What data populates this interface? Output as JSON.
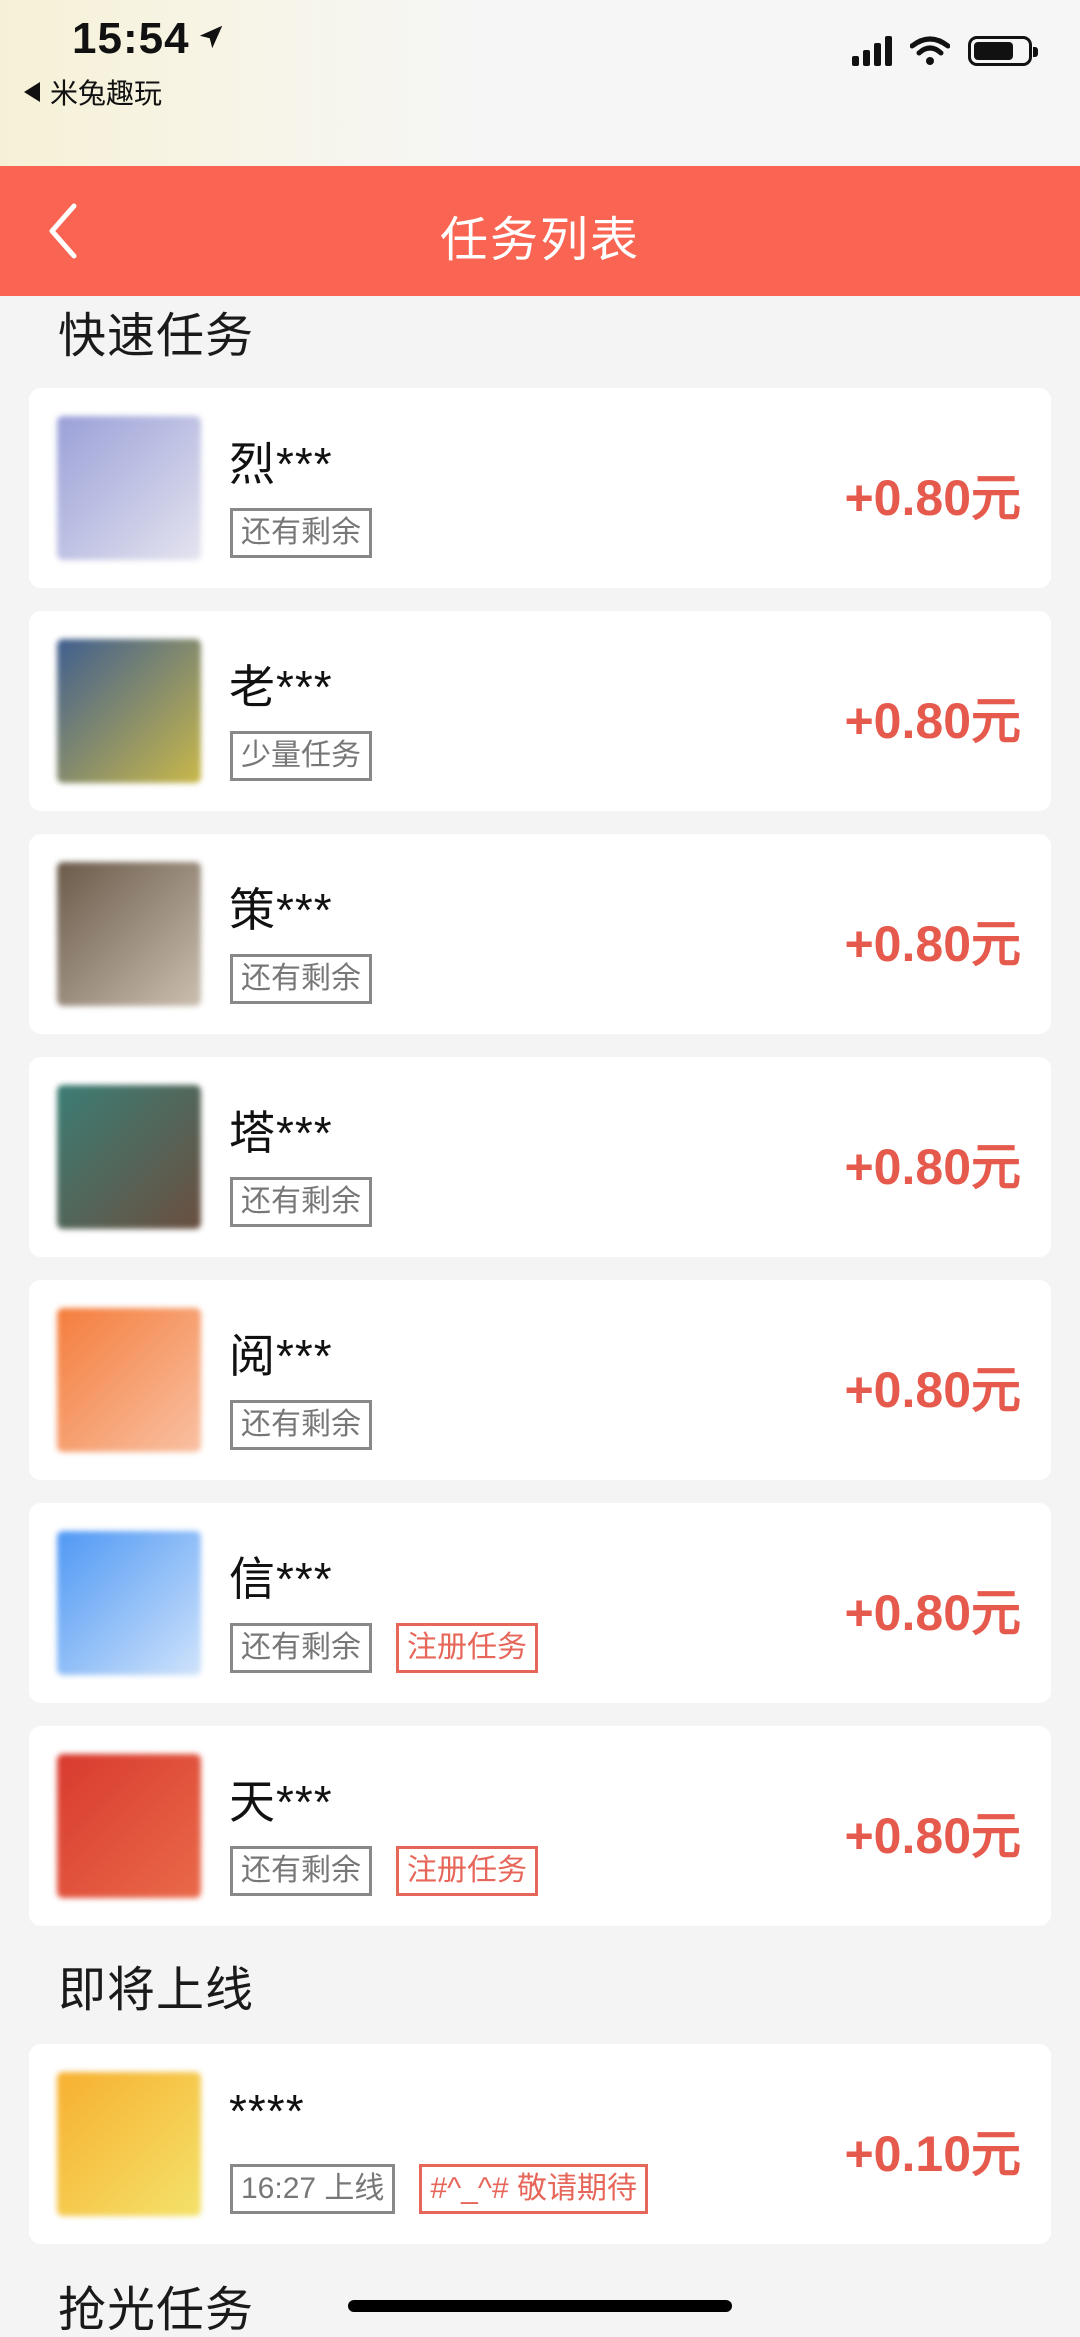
{
  "status_bar": {
    "time": "15:54",
    "back_app": "米兔趣玩",
    "battery_level": 0.75
  },
  "header": {
    "title": "任务列表"
  },
  "sections": {
    "quick": "快速任务",
    "upcoming": "即将上线",
    "soldout": "抢光任务"
  },
  "quick_tasks": [
    {
      "name": "烈***",
      "tags": [
        "还有剩余"
      ],
      "reward": "+0.80元",
      "thumb": [
        "#9aa0d8",
        "#e4e4ef"
      ]
    },
    {
      "name": "老***",
      "tags": [
        "少量任务"
      ],
      "reward": "+0.80元",
      "thumb": [
        "#3f5e8f",
        "#c9b84a"
      ]
    },
    {
      "name": "策***",
      "tags": [
        "还有剩余"
      ],
      "reward": "+0.80元",
      "thumb": [
        "#6a5a4a",
        "#cbbfb0"
      ]
    },
    {
      "name": "塔***",
      "tags": [
        "还有剩余"
      ],
      "reward": "+0.80元",
      "thumb": [
        "#3b7d74",
        "#6a4f40"
      ]
    },
    {
      "name": "阅***",
      "tags": [
        "还有剩余"
      ],
      "reward": "+0.80元",
      "thumb": [
        "#f47d3c",
        "#f9c1a3"
      ]
    },
    {
      "name": "信***",
      "tags": [
        "还有剩余",
        "注册任务"
      ],
      "reward": "+0.80元",
      "thumb": [
        "#4f98f4",
        "#cfe3fb"
      ]
    },
    {
      "name": "天***",
      "tags": [
        "还有剩余",
        "注册任务"
      ],
      "reward": "+0.80元",
      "thumb": [
        "#d83a2e",
        "#ea6a4a"
      ]
    }
  ],
  "upcoming_tasks": [
    {
      "name": "****",
      "tags": [
        "16:27 上线",
        "#^_^# 敬请期待"
      ],
      "reward": "+0.10元",
      "thumb": [
        "#f7b030",
        "#f4e26a"
      ]
    }
  ],
  "colors": {
    "header": "#f96552",
    "reward": "#e55a4d",
    "tag_red": "#e7665a",
    "tag_gray": "#888888"
  }
}
